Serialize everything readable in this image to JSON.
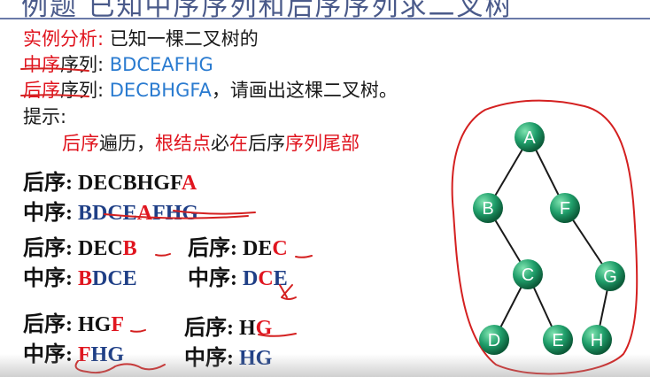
{
  "header": {
    "title": "例题   已知中序序列和后序序列求二叉树"
  },
  "intro": {
    "analysis_label": "实例分析:",
    "analysis_text": " 已知一棵二叉树的",
    "inorder_label": "中序",
    "inorder_suffix": "序列: ",
    "inorder_value": "BDCEAFHG",
    "postorder_label": "后序",
    "postorder_suffix": "序列: ",
    "postorder_value": "DECBHGFA",
    "postorder_tail": "，请画出这棵二叉树。",
    "hint_label": "提示:"
  },
  "hint": {
    "p1": "后序",
    "p2": "遍历，",
    "p3": "根结点",
    "p4": "必",
    "p5": "在",
    "p6": "后序",
    "p7": "序列尾部"
  },
  "steps": {
    "post_label": "后序:",
    "in_label": "中序:",
    "s1": {
      "post_main": "DECBHGF",
      "post_root": "A",
      "in_left": "BDCE",
      "in_root": "A",
      "in_right": "FHG"
    },
    "s2": {
      "post_main": "DEC",
      "post_root": "B",
      "in_root": "B",
      "in_rest": "DCE"
    },
    "s3": {
      "post_main": "DE",
      "post_root": "C",
      "in_left": "D",
      "in_root": "C",
      "in_right": "E"
    },
    "s4": {
      "post_main": "HG",
      "post_root": "F",
      "in_root": "F",
      "in_rest": "HG"
    },
    "s5": {
      "post_main": "H",
      "post_root": "G",
      "in_left": "HG"
    }
  },
  "tree": {
    "nodes": [
      {
        "id": "A",
        "label": "A"
      },
      {
        "id": "B",
        "label": "B"
      },
      {
        "id": "F",
        "label": "F"
      },
      {
        "id": "C",
        "label": "C"
      },
      {
        "id": "G",
        "label": "G"
      },
      {
        "id": "D",
        "label": "D"
      },
      {
        "id": "E",
        "label": "E"
      },
      {
        "id": "H",
        "label": "H"
      }
    ],
    "edges": [
      [
        "A",
        "B"
      ],
      [
        "A",
        "F"
      ],
      [
        "B",
        "C"
      ],
      [
        "F",
        "G"
      ],
      [
        "C",
        "D"
      ],
      [
        "C",
        "E"
      ],
      [
        "G",
        "H"
      ]
    ],
    "node_color": "#1f9e6a",
    "ink_color": "#d42020"
  }
}
